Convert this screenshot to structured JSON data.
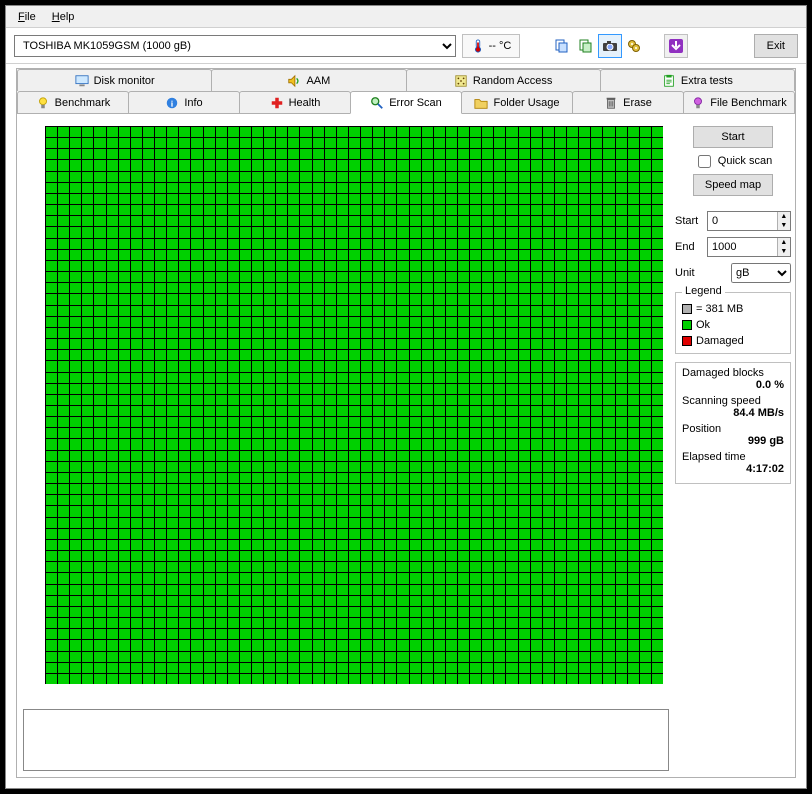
{
  "menu": {
    "file": "File",
    "help": "Help"
  },
  "toolbar": {
    "drive": "TOSHIBA MK1059GSM (1000 gB)",
    "temp": "-- °C",
    "exit": "Exit"
  },
  "tabs_row1": [
    {
      "label": "Disk monitor"
    },
    {
      "label": "AAM"
    },
    {
      "label": "Random Access"
    },
    {
      "label": "Extra tests"
    }
  ],
  "tabs_row2": [
    {
      "label": "Benchmark"
    },
    {
      "label": "Info"
    },
    {
      "label": "Health"
    },
    {
      "label": "Error Scan"
    },
    {
      "label": "Folder Usage"
    },
    {
      "label": "Erase"
    },
    {
      "label": "File Benchmark"
    }
  ],
  "side": {
    "start_btn": "Start",
    "quick_scan": "Quick scan",
    "speed_map_btn": "Speed map",
    "start_label": "Start",
    "end_label": "End",
    "unit_label": "Unit",
    "start_val": "0",
    "end_val": "1000",
    "unit_val": "gB",
    "legend_title": "Legend",
    "legend_block": "= 381 MB",
    "legend_ok": "Ok",
    "legend_damaged": "Damaged",
    "damaged_label": "Damaged blocks",
    "damaged_val": "0.0 %",
    "speed_label": "Scanning speed",
    "speed_val": "84.4 MB/s",
    "pos_label": "Position",
    "pos_val": "999 gB",
    "time_label": "Elapsed time",
    "time_val": "4:17:02"
  },
  "colors": {
    "ok": "#00d000",
    "damaged": "#e00000",
    "block": "#b0b0b0"
  },
  "grid": {
    "cols": 51,
    "rows": 50
  }
}
